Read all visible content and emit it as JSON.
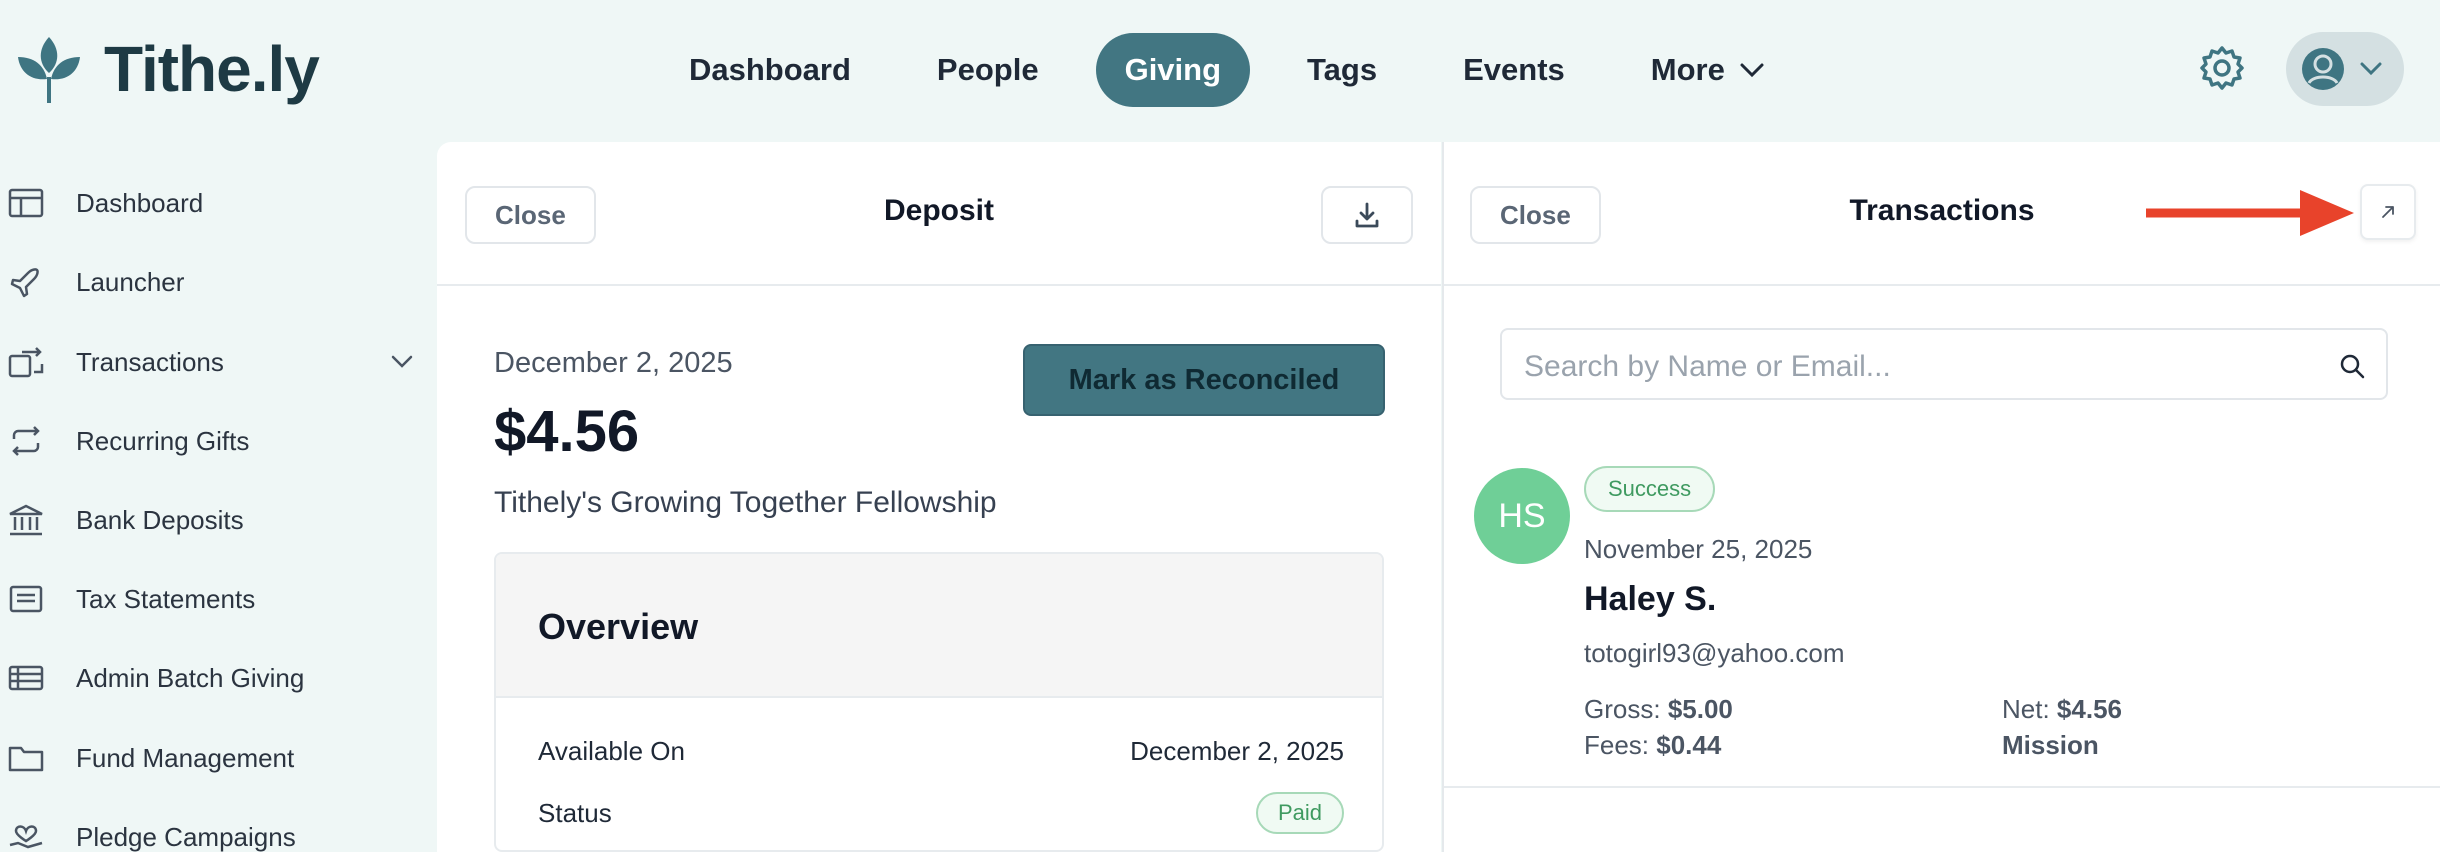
{
  "brand": {
    "name": "Tithe.ly",
    "accent": "#427682"
  },
  "nav": {
    "items": [
      {
        "label": "Dashboard",
        "active": false
      },
      {
        "label": "People",
        "active": false
      },
      {
        "label": "Giving",
        "active": true
      },
      {
        "label": "Tags",
        "active": false
      },
      {
        "label": "Events",
        "active": false
      },
      {
        "label": "More",
        "active": false
      }
    ]
  },
  "sidebar": {
    "items": [
      {
        "label": "Dashboard",
        "icon": "layout-icon"
      },
      {
        "label": "Launcher",
        "icon": "plane-icon"
      },
      {
        "label": "Transactions",
        "icon": "transfer-icon"
      },
      {
        "label": "Recurring Gifts",
        "icon": "repeat-icon"
      },
      {
        "label": "Bank Deposits",
        "icon": "bank-icon"
      },
      {
        "label": "Tax Statements",
        "icon": "receipt-icon"
      },
      {
        "label": "Admin Batch Giving",
        "icon": "table-icon"
      },
      {
        "label": "Fund Management",
        "icon": "folder-icon"
      },
      {
        "label": "Pledge Campaigns",
        "icon": "hand-heart-icon"
      }
    ]
  },
  "deposit": {
    "close_label": "Close",
    "title": "Deposit",
    "date": "December 2, 2025",
    "amount": "$4.56",
    "organization": "Tithely's Growing Together Fellowship",
    "reconcile_label": "Mark as Reconciled",
    "overview": {
      "title": "Overview",
      "available_on_label": "Available On",
      "available_on_value": "December 2, 2025",
      "status_label": "Status",
      "status_value": "Paid"
    }
  },
  "transactions": {
    "close_label": "Close",
    "title": "Transactions",
    "search_placeholder": "Search by Name or Email...",
    "items": [
      {
        "initials": "HS",
        "status": "Success",
        "date": "November 25, 2025",
        "name": "Haley S.",
        "email": "totogirl93@yahoo.com",
        "gross_label": "Gross:",
        "gross": "$5.00",
        "fees_label": "Fees:",
        "fees": "$0.44",
        "net_label": "Net:",
        "net": "$4.56",
        "fund": "Mission"
      }
    ]
  }
}
